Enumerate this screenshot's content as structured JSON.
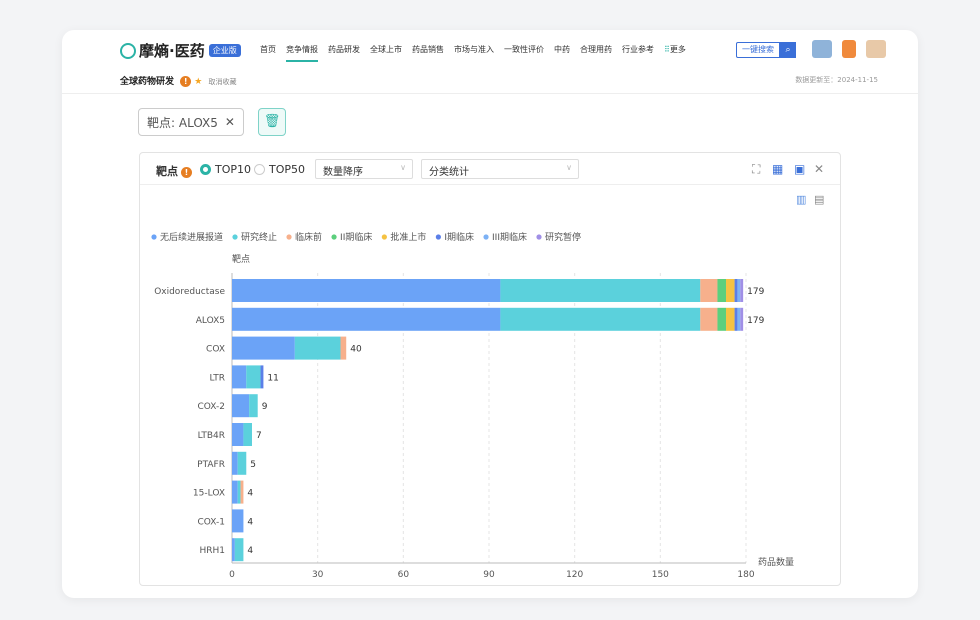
{
  "header": {
    "logo_text": "摩熵·医药",
    "logo_badge": "企业版",
    "nav": [
      "首页",
      "竞争情报",
      "药品研发",
      "全球上市",
      "药品销售",
      "市场与准入",
      "一致性评价",
      "中药",
      "合理用药",
      "行业参考"
    ],
    "nav_more": "更多",
    "search_label": "一键搜索",
    "breadcrumb": "全球药物研发",
    "breadcrumb_extra": "取消收藏",
    "updated": "数据更新至：2024-11-15"
  },
  "filter": {
    "tag_label": "靶点: ALOX5"
  },
  "panel": {
    "title": "靶点",
    "radio_top10": "TOP10",
    "radio_top50": "TOP50",
    "sort_select": "数量降序",
    "stat_select": "分类统计"
  },
  "colors": {
    "accent": "#2bb3a6",
    "brand_blue": "#3a6fd8"
  },
  "chart_data": {
    "type": "bar",
    "orientation": "horizontal",
    "stacked": true,
    "ylabel": "靶点",
    "xlabel": "药品数量",
    "xlim": [
      0,
      180
    ],
    "xticks": [
      0,
      30,
      60,
      90,
      120,
      150,
      180
    ],
    "grid": true,
    "legend_position": "top-left",
    "categories": [
      "Oxidoreductase",
      "ALOX5",
      "COX",
      "LTR",
      "COX-2",
      "LTB4R",
      "PTAFR",
      "15-LOX",
      "COX-1",
      "HRH1"
    ],
    "totals": [
      179,
      179,
      40,
      11,
      9,
      7,
      5,
      4,
      4,
      4
    ],
    "series": [
      {
        "name": "无后续进展报道",
        "color": "#6ba3f7",
        "values": [
          94,
          94,
          22,
          5,
          6,
          4,
          2,
          2,
          4,
          1
        ]
      },
      {
        "name": "研究终止",
        "color": "#5bd1dc",
        "values": [
          70,
          70,
          16,
          5,
          3,
          3,
          3,
          1,
          0,
          3
        ]
      },
      {
        "name": "临床前",
        "color": "#f7b08c",
        "values": [
          6,
          6,
          2,
          0,
          0,
          0,
          0,
          1,
          0,
          0
        ]
      },
      {
        "name": "II期临床",
        "color": "#5ccf7d",
        "values": [
          3,
          3,
          0,
          0,
          0,
          0,
          0,
          0,
          0,
          0
        ]
      },
      {
        "name": "批准上市",
        "color": "#f5c242",
        "values": [
          3,
          3,
          0,
          0,
          0,
          0,
          0,
          0,
          0,
          0
        ]
      },
      {
        "name": "I期临床",
        "color": "#5b7fe8",
        "values": [
          1,
          1,
          0,
          1,
          0,
          0,
          0,
          0,
          0,
          0
        ]
      },
      {
        "name": "III期临床",
        "color": "#7cb1f5",
        "values": [
          1,
          1,
          0,
          0,
          0,
          0,
          0,
          0,
          0,
          0
        ]
      },
      {
        "name": "研究暂停",
        "color": "#a08fe6",
        "values": [
          1,
          1,
          0,
          0,
          0,
          0,
          0,
          0,
          0,
          0
        ]
      }
    ]
  }
}
